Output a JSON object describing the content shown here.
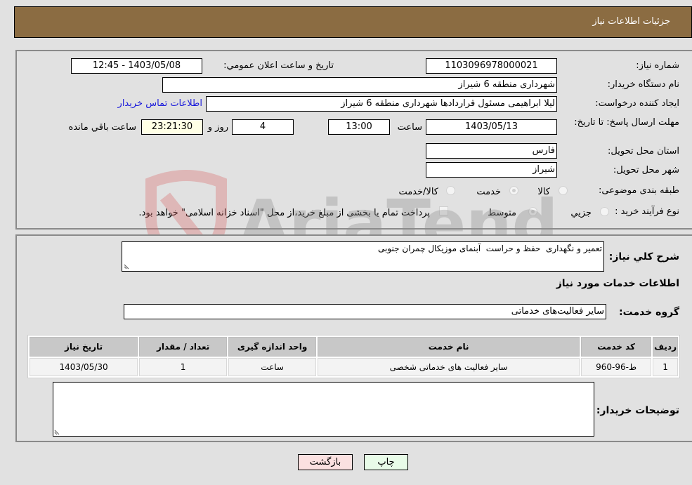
{
  "header": {
    "title": "جزئیات اطلاعات نیاز"
  },
  "details": {
    "need_number_label": "شماره نیاز:",
    "need_number": "1103096978000021",
    "announce_label": "تاریخ و ساعت اعلان عمومي:",
    "announce_value": "1403/05/08 - 12:45",
    "buyer_org_label": "نام دستگاه خريدار:",
    "buyer_org": "شهرداری منطقه 6 شیراز",
    "requester_label": "ايجاد کننده درخواست:",
    "requester": "لیلا ابراهیمی مسئول قراردادها شهرداری منطقه 6 شیراز",
    "buyer_contact_link": "اطلاعات تماس خريدار",
    "deadline_label": "مهلت ارسال پاسخ: تا تاریخ:",
    "deadline_date": "1403/05/13",
    "time_label": "ساعت",
    "deadline_time": "13:00",
    "days_value": "4",
    "days_label": "روز و",
    "remaining_time": "23:21:30",
    "remaining_label": "ساعت باقي مانده",
    "province_label": "استان محل تحویل:",
    "province": "فارس",
    "city_label": "شهر محل تحویل:",
    "city": "شیراز",
    "category_label": "طبقه بندی موضوعی:",
    "category_options": [
      {
        "label": "کالا",
        "checked": false
      },
      {
        "label": "خدمت",
        "checked": true
      },
      {
        "label": "کالا/خدمت",
        "checked": false
      }
    ],
    "process_label": "نوع فرآيند خريد :",
    "process_options": [
      {
        "label": "جزيي",
        "checked": false
      },
      {
        "label": "متوسط",
        "checked": true
      }
    ],
    "treasury_note": "پرداخت تمام يا بخشی از مبلغ خريد،از محل \"اسناد خزانه اسلامی\" خواهد بود.",
    "treasury_checked": false
  },
  "services": {
    "summary_label": "شرح کلي نياز:",
    "summary": "تعمیر و نگهداری  حفظ و حراست  آبنمای موزیکال چمران جنوبی",
    "section_title": "اطلاعات خدمات مورد نياز",
    "group_label": "گروه خدمت:",
    "group_value": "ساير فعاليت‌هاى خدماتى",
    "table": {
      "headers": [
        "رديف",
        "کد خدمت",
        "نام خدمت",
        "واحد اندازه گيری",
        "تعداد / مقدار",
        "تاريخ نياز"
      ],
      "rows": [
        [
          "1",
          "ط-96-960",
          "ساير فعاليت هاى خدماتى شخصى",
          "ساعت",
          "1",
          "1403/05/30"
        ]
      ]
    },
    "buyer_notes_label": "توضيحات خريدار:",
    "buyer_notes": ""
  },
  "buttons": {
    "print": "چاپ",
    "back": "بازگشت"
  },
  "watermark": {
    "text": "AriaTender.neT"
  }
}
